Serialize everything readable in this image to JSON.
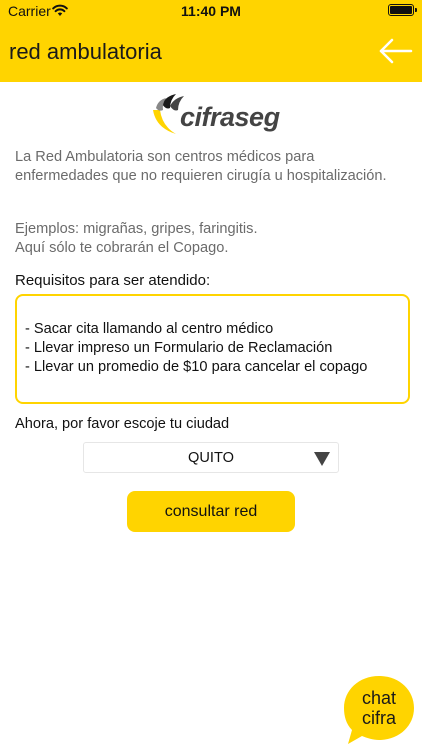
{
  "status_bar": {
    "carrier": "Carrier",
    "time": "11:40 PM",
    "wifi_icon": "wifi-icon",
    "battery_icon": "battery-icon"
  },
  "header": {
    "title": "red ambulatoria",
    "back_icon": "arrow-left-icon",
    "background_color": "#ffd400"
  },
  "logo": {
    "text": "cifraseg"
  },
  "main": {
    "intro": "La Red Ambulatoria son centros médicos para enfermedades que no requieren cirugía u hospitalización.",
    "examples_line1": "Ejemplos: migrañas, gripes, faringitis.",
    "examples_line2": "Aquí sólo te cobrarán el Copago.",
    "requirements_label": "Requisitos para ser atendido:",
    "requirements": [
      "- Sacar cita llamando al centro médico",
      "- Llevar impreso un Formulario de Reclamación",
      "- Llevar un promedio de $10 para cancelar el copago"
    ],
    "city_label": "Ahora, por favor escoje tu ciudad",
    "city_selected": "QUITO",
    "submit_label": "consultar red"
  },
  "chat": {
    "line1": "chat",
    "line2": "cifra"
  },
  "colors": {
    "accent": "#ffd400",
    "muted_text": "#6b6b6b"
  }
}
